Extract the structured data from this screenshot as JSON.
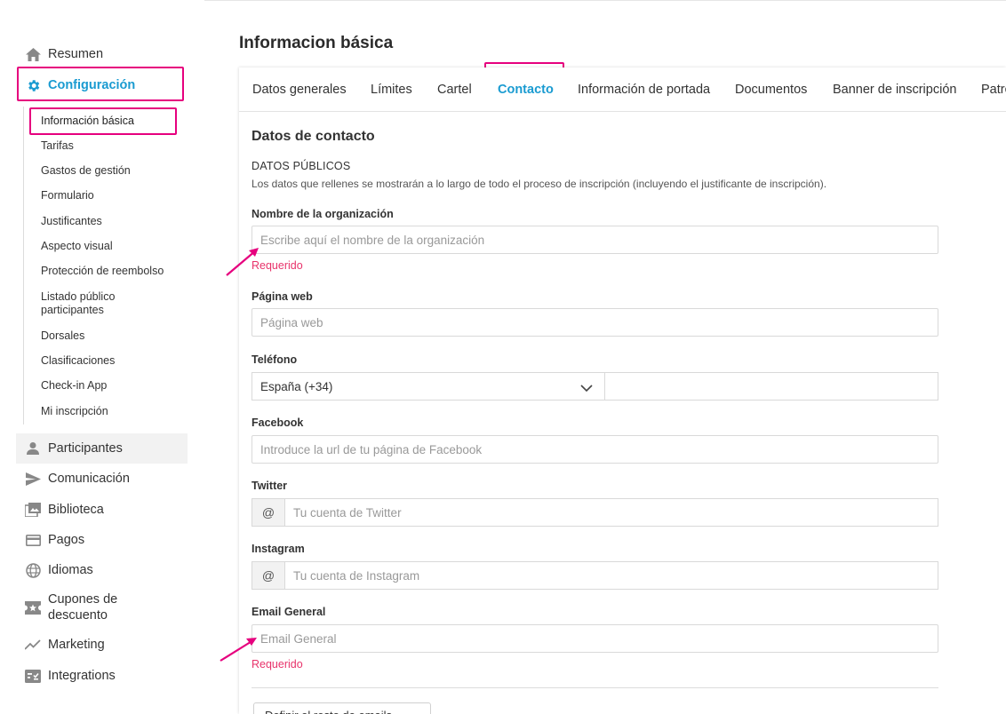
{
  "sidebar": {
    "items": [
      {
        "label": "Resumen",
        "icon": "home-icon"
      },
      {
        "label": "Configuración",
        "icon": "gear-icon"
      },
      {
        "label": "Participantes",
        "icon": "person-icon"
      },
      {
        "label": "Comunicación",
        "icon": "send-icon"
      },
      {
        "label": "Biblioteca",
        "icon": "image-library-icon"
      },
      {
        "label": "Pagos",
        "icon": "credit-card-icon"
      },
      {
        "label": "Idiomas",
        "icon": "globe-icon"
      },
      {
        "label": "Cupones de descuento",
        "icon": "ticket-star-icon"
      },
      {
        "label": "Marketing",
        "icon": "trending-icon"
      },
      {
        "label": "Integrations",
        "icon": "integrations-icon"
      }
    ],
    "sub_items": [
      "Información básica",
      "Tarifas",
      "Gastos de gestión",
      "Formulario",
      "Justificantes",
      "Aspecto visual",
      "Protección de reembolso",
      "Listado público participantes",
      "Dorsales",
      "Clasificaciones",
      "Check-in App",
      "Mi inscripción"
    ]
  },
  "page": {
    "title": "Informacion básica"
  },
  "tabs": [
    "Datos generales",
    "Límites",
    "Cartel",
    "Contacto",
    "Información de portada",
    "Documentos",
    "Banner de inscripción",
    "Patro"
  ],
  "form": {
    "section_title": "Datos de contacto",
    "public_label": "DATOS PÚBLICOS",
    "public_desc": "Los datos que rellenes se mostrarán a lo largo de todo el proceso de inscripción (incluyendo el justificante de inscripción).",
    "org_label": "Nombre de la organización",
    "org_placeholder": "Escribe aquí el nombre de la organización",
    "required_text": "Requerido",
    "web_label": "Página web",
    "web_placeholder": "Página web",
    "phone_label": "Teléfono",
    "phone_country": "España (+34)",
    "facebook_label": "Facebook",
    "facebook_placeholder": "Introduce la url de tu página de Facebook",
    "twitter_label": "Twitter",
    "twitter_placeholder": "Tu cuenta de Twitter",
    "instagram_label": "Instagram",
    "instagram_placeholder": "Tu cuenta de Instagram",
    "at_symbol": "@",
    "email_label": "Email General",
    "email_placeholder": "Email General",
    "more_emails_button": "Definir el resto de emails ⌄"
  },
  "colors": {
    "accent": "#1a9bd1",
    "highlight": "#e6007e",
    "error": "#e8336b"
  }
}
